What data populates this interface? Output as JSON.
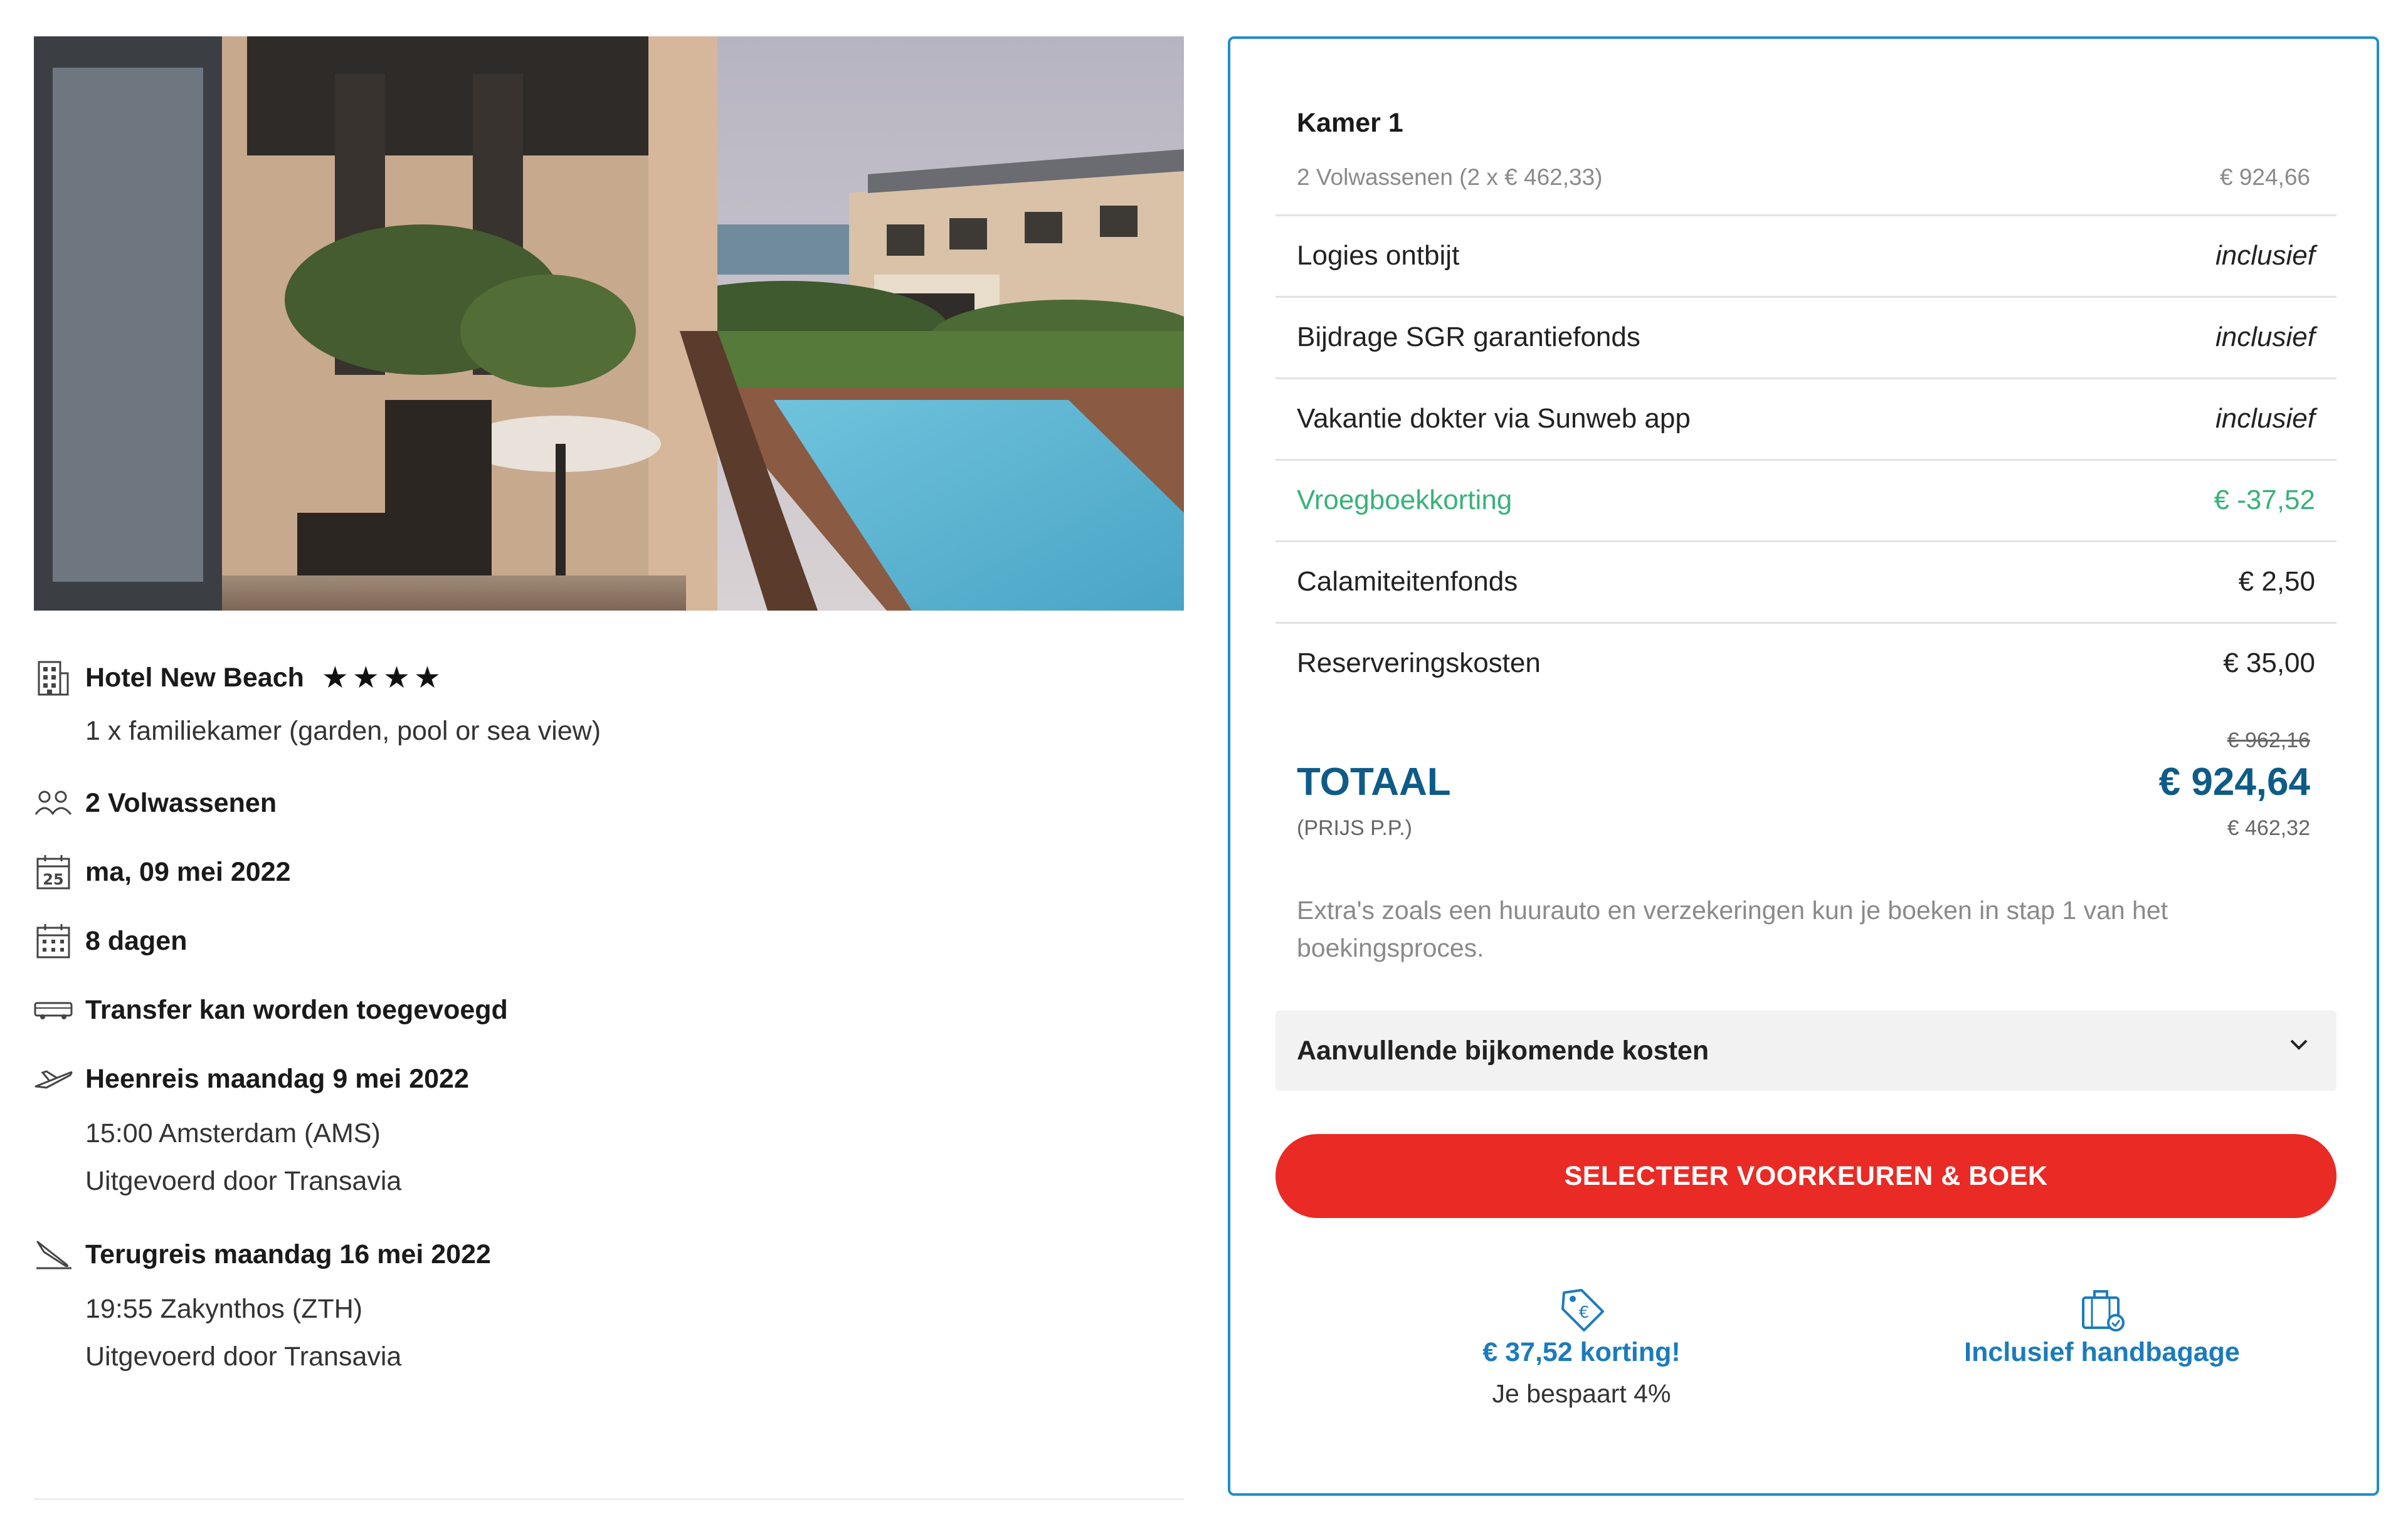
{
  "hotel": {
    "name": "Hotel New Beach",
    "stars_text": "★★★★",
    "room": "1 x familiekamer (garden, pool or sea view)"
  },
  "trip": {
    "travellers": "2 Volwassenen",
    "date": "ma, 09 mei 2022",
    "calendar_day": "25",
    "duration": "8 dagen",
    "transfer": "Transfer kan worden toegevoegd",
    "outbound": {
      "title": "Heenreis maandag 9 mei 2022",
      "time": "15:00 Amsterdam (AMS)",
      "carrier": "Uitgevoerd door Transavia"
    },
    "return": {
      "title": "Terugreis maandag 16 mei 2022",
      "time": "19:55 Zakynthos (ZTH)",
      "carrier": "Uitgevoerd door Transavia"
    }
  },
  "summary": {
    "room_title": "Kamer 1",
    "room_detail": "2 Volwassenen (2 x € 462,33)",
    "room_amount": "€ 924,66",
    "items": [
      {
        "label": "Logies ontbijt",
        "value": "inclusief"
      },
      {
        "label": "Bijdrage SGR garantiefonds",
        "value": "inclusief"
      },
      {
        "label": "Vakantie dokter via Sunweb app",
        "value": "inclusief"
      },
      {
        "label": "Vroegboekkorting",
        "value": "€ -37,52"
      },
      {
        "label": "Calamiteitenfonds",
        "value": "€ 2,50"
      },
      {
        "label": "Reserveringskosten",
        "value": "€ 35,00"
      }
    ],
    "old_price": "€ 962,16",
    "total_label": "TOTAAL",
    "total_amount": "€ 924,64",
    "pp_label": "(PRIJS P.P.)",
    "pp_amount": "€ 462,32",
    "note": "Extra's zoals een huurauto en verzekeringen kun je boeken in stap 1 van het boekingsproces.",
    "accordion_label": "Aanvullende bijkomende kosten",
    "cta_label": "SELECTEER VOORKEUREN & BOEK",
    "usp_discount_title": "€ 37,52 korting!",
    "usp_discount_sub": "Je bespaart 4%",
    "usp_baggage_title": "Inclusief handbagage"
  },
  "colors": {
    "accent_blue": "#1f8ec9",
    "total_blue": "#0e5b88",
    "discount_green": "#38b27a",
    "cta_red": "#ea2a24"
  },
  "icons": [
    "hotel-icon",
    "travellers-icon",
    "calendar-date-icon",
    "calendar-duration-icon",
    "transfer-bus-icon",
    "plane-departure-icon",
    "plane-arrival-icon",
    "chevron-down-icon",
    "discount-tag-icon",
    "hand-baggage-icon"
  ]
}
